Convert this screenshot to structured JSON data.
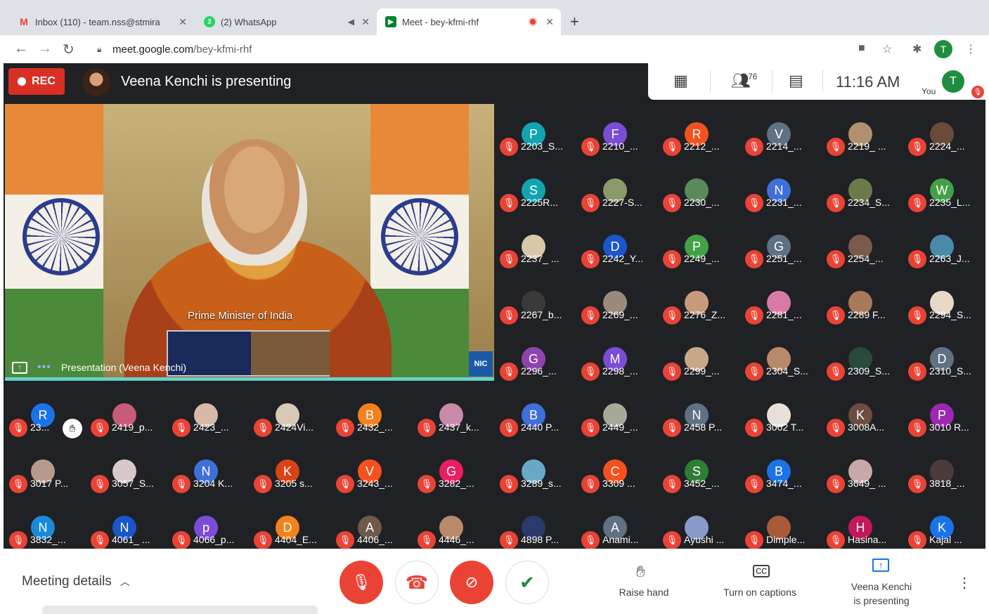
{
  "tabs": [
    {
      "title": "Inbox (110) - team.nss@stmira",
      "favicon": "gmail-icon",
      "color": "#ea4335",
      "glyph": "M"
    },
    {
      "title": "(2) WhatsApp",
      "favicon": "whatsapp-icon",
      "color": "#25d366",
      "glyph": "2"
    },
    {
      "title": "Meet - bey-kfmi-rhf",
      "favicon": "meet-icon",
      "color": "#00832d",
      "glyph": "▶"
    }
  ],
  "address": {
    "host": "meet.google.com",
    "path": "/bey-kfmi-rhf"
  },
  "profile_initial": "T",
  "meet": {
    "rec_label": "REC",
    "presenting_text": "Veena Kenchi is presenting",
    "participant_count": "76",
    "time": "11:16 AM",
    "you_label": "You",
    "you_initial": "T",
    "presentation": {
      "caption": "Prime Minister of India",
      "label": "Presentation (Veena Kenchi)",
      "logo_text": "NIC"
    }
  },
  "participants": [
    {
      "name": "2203_S...",
      "initial": "P",
      "color": "#12a4af"
    },
    {
      "name": "2210_...",
      "initial": "F",
      "color": "#7b4cd6"
    },
    {
      "name": "2212_...",
      "initial": "R",
      "color": "#f4511e"
    },
    {
      "name": "2214_...",
      "initial": "V",
      "color": "#5f7182"
    },
    {
      "name": "2219_ ...",
      "initial": "",
      "color": "#b09070"
    },
    {
      "name": "2224_...",
      "initial": "",
      "color": "#6a4a3a"
    },
    {
      "name": "2225R...",
      "initial": "S",
      "color": "#12a4af"
    },
    {
      "name": "2227-S...",
      "initial": "",
      "color": "#8a9a6a"
    },
    {
      "name": "2230_...",
      "initial": "",
      "color": "#5a8a5a"
    },
    {
      "name": "2231_...",
      "initial": "N",
      "color": "#3f6fd9"
    },
    {
      "name": "2234_S...",
      "initial": "",
      "color": "#6a7a4a"
    },
    {
      "name": "2235_L...",
      "initial": "W",
      "color": "#43a047"
    },
    {
      "name": "2237_ ...",
      "initial": "",
      "color": "#d8c8a8"
    },
    {
      "name": "2242_Y...",
      "initial": "D",
      "color": "#1a56c9"
    },
    {
      "name": "2249_...",
      "initial": "P",
      "color": "#43a047"
    },
    {
      "name": "2251_...",
      "initial": "G",
      "color": "#5f7182"
    },
    {
      "name": "2254_...",
      "initial": "",
      "color": "#7a5a4a"
    },
    {
      "name": "2263_J...",
      "initial": "",
      "color": "#4a8aa8"
    },
    {
      "name": "2267_b...",
      "initial": "",
      "color": "#3a3a3a"
    },
    {
      "name": "2269_...",
      "initial": "",
      "color": "#9a8a7a"
    },
    {
      "name": "2276_Z...",
      "initial": "",
      "color": "#c89a7a"
    },
    {
      "name": "2281_...",
      "initial": "",
      "color": "#d87aa8"
    },
    {
      "name": "2289 F...",
      "initial": "",
      "color": "#a87a5a"
    },
    {
      "name": "2294_S...",
      "initial": "",
      "color": "#e8d8c8"
    },
    {
      "name": "2296_...",
      "initial": "G",
      "color": "#8e44ad"
    },
    {
      "name": "2298_...",
      "initial": "M",
      "color": "#7b4cd6"
    },
    {
      "name": "2299_...",
      "initial": "",
      "color": "#c8a888"
    },
    {
      "name": "2304_S...",
      "initial": "",
      "color": "#b88a6a"
    },
    {
      "name": "2309_S...",
      "initial": "",
      "color": "#2a4a3a"
    },
    {
      "name": "2310_S...",
      "initial": "D",
      "color": "#5f7182"
    },
    {
      "name": "23...",
      "initial": "R",
      "color": "#1a73e8",
      "hand": true
    },
    {
      "name": "2419_p...",
      "initial": "",
      "color": "#c85a7a"
    },
    {
      "name": "2423_...",
      "initial": "",
      "color": "#d8b8a8"
    },
    {
      "name": "2424Vi...",
      "initial": "",
      "color": "#d8c8b8"
    },
    {
      "name": "2432_...",
      "initial": "B",
      "color": "#f4811e"
    },
    {
      "name": "2437_k...",
      "initial": "",
      "color": "#c88aa8"
    },
    {
      "name": "2440 P...",
      "initial": "B",
      "color": "#3f6fd9"
    },
    {
      "name": "2449_...",
      "initial": "",
      "color": "#a8a898"
    },
    {
      "name": "2458 P...",
      "initial": "N",
      "color": "#5f7182"
    },
    {
      "name": "3002 T...",
      "initial": "",
      "color": "#e8e0d8"
    },
    {
      "name": "3008A...",
      "initial": "K",
      "color": "#6d4c41"
    },
    {
      "name": "3010 R...",
      "initial": "P",
      "color": "#9c27b0"
    },
    {
      "name": "3017 P...",
      "initial": "",
      "color": "#b89a8a"
    },
    {
      "name": "3057_S...",
      "initial": "",
      "color": "#d8c8c8"
    },
    {
      "name": "3204 K...",
      "initial": "N",
      "color": "#3f6fd9"
    },
    {
      "name": "3205 s...",
      "initial": "K",
      "color": "#d84315"
    },
    {
      "name": "3243_...",
      "initial": "V",
      "color": "#f4511e"
    },
    {
      "name": "3282_...",
      "initial": "G",
      "color": "#e91e63"
    },
    {
      "name": "3289_s...",
      "initial": "",
      "color": "#6aa8c8"
    },
    {
      "name": "3309 ...",
      "initial": "C",
      "color": "#f4511e"
    },
    {
      "name": "3452_...",
      "initial": "S",
      "color": "#2e7d32"
    },
    {
      "name": "3474_...",
      "initial": "B",
      "color": "#1a73e8"
    },
    {
      "name": "3649_ ...",
      "initial": "",
      "color": "#c8a8a8"
    },
    {
      "name": "3818_...",
      "initial": "",
      "color": "#4a3a3a"
    },
    {
      "name": "3832_...",
      "initial": "N",
      "color": "#1a8ad8"
    },
    {
      "name": "4061_ ...",
      "initial": "N",
      "color": "#1a56c9"
    },
    {
      "name": "4066_p...",
      "initial": "p",
      "color": "#7b4cd6"
    },
    {
      "name": "4404_E...",
      "initial": "D",
      "color": "#f4811e"
    },
    {
      "name": "4406_...",
      "initial": "A",
      "color": "#6d5a4a"
    },
    {
      "name": "4446_...",
      "initial": "",
      "color": "#b88a6a"
    },
    {
      "name": "4898 P...",
      "initial": "",
      "color": "#2a3a6a"
    },
    {
      "name": "Anami...",
      "initial": "A",
      "color": "#5f7182"
    },
    {
      "name": "Ayushi ...",
      "initial": "",
      "color": "#8a9ac8"
    },
    {
      "name": "Dimple...",
      "initial": "",
      "color": "#a85a3a"
    },
    {
      "name": "Hasina...",
      "initial": "H",
      "color": "#c2185b"
    },
    {
      "name": "Kajal ...",
      "initial": "K",
      "color": "#1a73e8"
    }
  ],
  "bottom": {
    "meeting_details": "Meeting details",
    "raise_hand": "Raise hand",
    "captions": "Turn on captions",
    "presenting_line1": "Veena Kenchi",
    "presenting_line2": "is presenting"
  }
}
